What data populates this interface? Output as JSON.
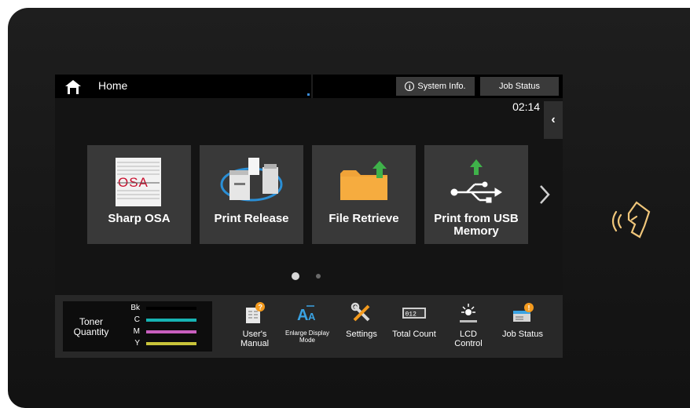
{
  "topbar": {
    "home_label": "Home",
    "system_info_label": "System Info.",
    "job_status_label": "Job Status",
    "time": "02:14 PM"
  },
  "tiles": [
    {
      "label": "Sharp OSA",
      "icon": "sharp-osa-icon"
    },
    {
      "label": "Print Release",
      "icon": "print-release-icon"
    },
    {
      "label": "File Retrieve",
      "icon": "file-retrieve-icon"
    },
    {
      "label": "Print from USB Memory",
      "icon": "usb-print-icon"
    }
  ],
  "osa_logo_text": "OSA",
  "pager": {
    "pages": 2,
    "current": 1
  },
  "toner": {
    "title": "Toner Quantity",
    "colors": [
      {
        "letter": "Bk",
        "color": "#000000"
      },
      {
        "letter": "C",
        "color": "#17b3b3"
      },
      {
        "letter": "M",
        "color": "#c85fbf"
      },
      {
        "letter": "Y",
        "color": "#c9c43a"
      }
    ]
  },
  "tools": [
    {
      "label": "User's Manual",
      "icon": "users-manual-icon"
    },
    {
      "label": "Enlarge Display Mode",
      "icon": "enlarge-display-icon"
    },
    {
      "label": "Settings",
      "icon": "settings-icon"
    },
    {
      "label": "Total Count",
      "icon": "total-count-icon",
      "counter": "012"
    },
    {
      "label": "LCD Control",
      "icon": "lcd-control-icon"
    },
    {
      "label": "Job Status",
      "icon": "job-status-icon"
    }
  ],
  "colors": {
    "accent_green": "#3fb24a",
    "folder_orange": "#f0a338",
    "badge_orange": "#f39a1e"
  }
}
